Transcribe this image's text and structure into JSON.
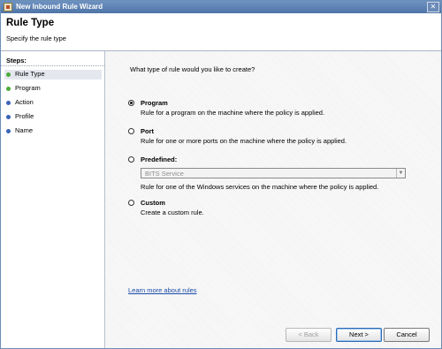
{
  "window": {
    "title": "New Inbound Rule Wizard",
    "close_glyph": "✕"
  },
  "header": {
    "title": "Rule Type",
    "subtitle": "Specify the rule type"
  },
  "sidebar": {
    "steps_title": "Steps:",
    "items": [
      {
        "label": "Rule Type",
        "status": "done"
      },
      {
        "label": "Program",
        "status": "done"
      },
      {
        "label": "Action",
        "status": "pending"
      },
      {
        "label": "Profile",
        "status": "pending"
      },
      {
        "label": "Name",
        "status": "pending"
      }
    ]
  },
  "main": {
    "question": "What type of rule would you like to create?",
    "options": [
      {
        "label": "Program",
        "description": "Rule for a program on the machine where the policy is applied.",
        "selected": true
      },
      {
        "label": "Port",
        "description": "Rule for one or more ports on the machine where the policy is applied.",
        "selected": false
      },
      {
        "label": "Predefined:",
        "description": "Rule for one of the Windows services on the machine where the policy is applied.",
        "selected": false
      },
      {
        "label": "Custom",
        "description": "Create a custom rule.",
        "selected": false
      }
    ],
    "predefined_select": {
      "value": "BITS Service",
      "enabled": false
    },
    "learn_more": "Learn more about rules"
  },
  "footer": {
    "back_label": "< Back",
    "next_label": "Next >",
    "cancel_label": "Cancel"
  },
  "colors": {
    "title_bar": "#5a7eb2",
    "link": "#1a4ca8",
    "step_done": "#4caa3a",
    "step_pending": "#3b63b8"
  }
}
